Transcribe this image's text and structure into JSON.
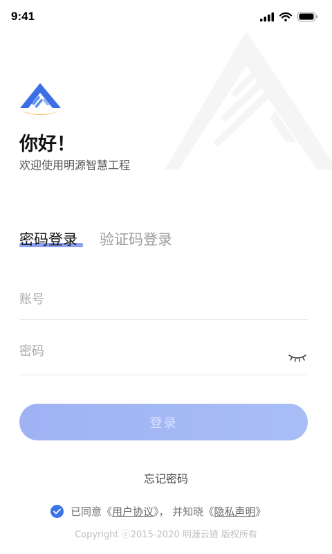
{
  "status_bar": {
    "time": "9:41"
  },
  "header": {
    "greeting": "你好！",
    "welcome": "欢迎使用明源智慧工程"
  },
  "tabs": [
    {
      "label": "密码登录",
      "active": true
    },
    {
      "label": "验证码登录",
      "active": false
    }
  ],
  "form": {
    "account_placeholder": "账号",
    "password_placeholder": "密码",
    "login_label": "登录",
    "forgot_label": "忘记密码"
  },
  "agreement": {
    "agreed": true,
    "prefix": "已同意《",
    "user_agreement": "用户协议",
    "middle": "》， 并知晓《",
    "privacy": "隐私声明",
    "suffix": "》"
  },
  "copyright": "Copyright ⓒ2015-2020 明源云链 版权所有",
  "colors": {
    "accent": "#3a74e8",
    "tab_underline": "#8ba2f0",
    "button": "#a3b7f5"
  }
}
